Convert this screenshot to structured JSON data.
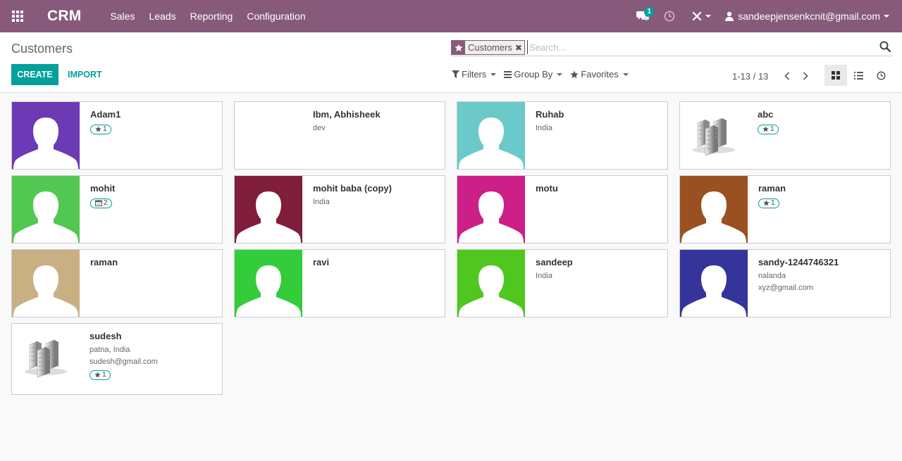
{
  "app": {
    "title": "CRM"
  },
  "menu": [
    "Sales",
    "Leads",
    "Reporting",
    "Configuration"
  ],
  "nav": {
    "chat_badge": "1",
    "user_email": "sandeepjensenkcnit@gmail.com"
  },
  "breadcrumb": "Customers",
  "buttons": {
    "create": "CREATE",
    "import": "IMPORT"
  },
  "search": {
    "facet_label": "Customers",
    "placeholder": "Search..."
  },
  "filters": {
    "filters": "Filters",
    "group_by": "Group By",
    "favorites": "Favorites"
  },
  "pager": {
    "value": "1-13 / 13"
  },
  "colors": {
    "brand": "#875a7b",
    "accent": "#00a09d"
  },
  "customers": [
    {
      "name": "Adam1",
      "lines": [],
      "badge": "1",
      "badge_icon": "star",
      "avatar": "person",
      "color": "#6c3ab5"
    },
    {
      "name": "Ibm, Abhisheek",
      "lines": [
        "dev"
      ],
      "badge": "",
      "badge_icon": "",
      "avatar": "none",
      "color": ""
    },
    {
      "name": "Ruhab",
      "lines": [
        "India"
      ],
      "badge": "",
      "badge_icon": "",
      "avatar": "person",
      "color": "#6cc9c9"
    },
    {
      "name": "abc",
      "lines": [],
      "badge": "1",
      "badge_icon": "star",
      "avatar": "company",
      "color": ""
    },
    {
      "name": "mohit",
      "lines": [],
      "badge": "2",
      "badge_icon": "calendar",
      "avatar": "person",
      "color": "#52c852"
    },
    {
      "name": "mohit baba (copy)",
      "lines": [
        "India"
      ],
      "badge": "",
      "badge_icon": "",
      "avatar": "person",
      "color": "#801d3a"
    },
    {
      "name": "motu",
      "lines": [],
      "badge": "",
      "badge_icon": "",
      "avatar": "person",
      "color": "#cc1f87"
    },
    {
      "name": "raman",
      "lines": [],
      "badge": "1",
      "badge_icon": "star",
      "avatar": "person",
      "color": "#9a5020"
    },
    {
      "name": "raman",
      "lines": [],
      "badge": "",
      "badge_icon": "",
      "avatar": "person",
      "color": "#c9b083"
    },
    {
      "name": "ravi",
      "lines": [],
      "badge": "",
      "badge_icon": "",
      "avatar": "person",
      "color": "#33cc3a"
    },
    {
      "name": "sandeep",
      "lines": [
        "India"
      ],
      "badge": "",
      "badge_icon": "",
      "avatar": "person",
      "color": "#4fc71f"
    },
    {
      "name": "sandy-1244746321",
      "lines": [
        "nalanda",
        "xyz@gmail.com"
      ],
      "badge": "",
      "badge_icon": "",
      "avatar": "person",
      "color": "#34349a"
    },
    {
      "name": "sudesh",
      "lines": [
        "patna, India",
        "sudesh@gmail.com"
      ],
      "badge": "1",
      "badge_icon": "star",
      "avatar": "company",
      "color": ""
    }
  ]
}
